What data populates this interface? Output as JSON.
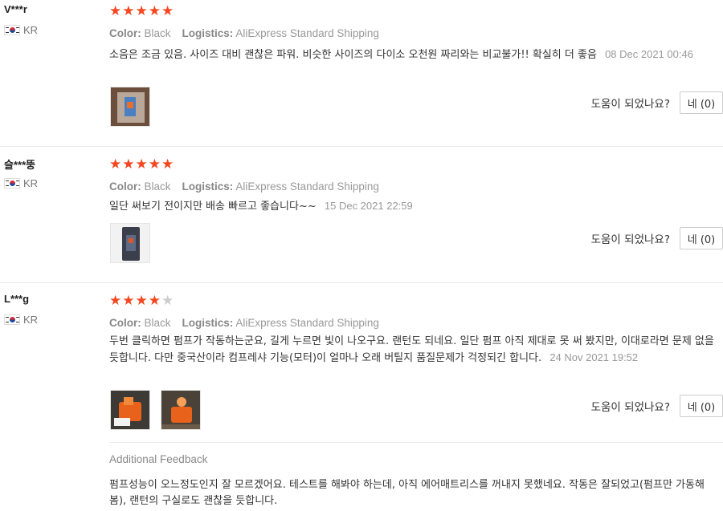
{
  "reviews": [
    {
      "user": "V***r",
      "country": "KR",
      "rating": 5,
      "color_label": "Color:",
      "color_value": "Black",
      "logistics_label": "Logistics:",
      "logistics_value": "AliExpress Standard Shipping",
      "text": "소음은 조금 있음. 사이즈 대비 괜찮은 파워. 비슷한 사이즈의 다이소 오천원 짜리와는 비교불가!! 확실히 더 좋음",
      "date": "08 Dec 2021 00:46",
      "helpful_question": "도움이 되었나요?",
      "yes_label": "네 (0)"
    },
    {
      "user": "슬***뚱",
      "country": "KR",
      "rating": 5,
      "color_label": "Color:",
      "color_value": "Black",
      "logistics_label": "Logistics:",
      "logistics_value": "AliExpress Standard Shipping",
      "text": "일단 써보기 전이지만 배송 빠르고 좋습니다~~",
      "date": "15 Dec 2021 22:59",
      "helpful_question": "도움이 되었나요?",
      "yes_label": "네 (0)"
    },
    {
      "user": "L***g",
      "country": "KR",
      "rating": 4,
      "color_label": "Color:",
      "color_value": "Black",
      "logistics_label": "Logistics:",
      "logistics_value": "AliExpress Standard Shipping",
      "text": "두번 클릭하면 펌프가 작동하는군요, 길게 누르면 빛이 나오구요. 랜턴도 되네요. 일단 펌프 아직 제대로 못 써 봤지만, 이대로라면 문제 없을 듯합니다. 다만 중국산이라 컴프레샤 기능(모터)이 얼마나 오래 버틸지 품질문제가 걱정되긴 합니다.",
      "date": "24 Nov 2021 19:52",
      "helpful_question": "도움이 되었나요?",
      "yes_label": "네 (0)",
      "additional_title": "Additional Feedback",
      "additional_text": "펌프성능이 오느정도인지 잘 모르겠어요. 테스트를 해봐야 하는데, 아직 에어매트리스를 꺼내지 못했네요. 작동은 잘되었고(펌프만 가동해 봄), 랜턴의 구실로도 괜찮을 듯합니다."
    }
  ],
  "icons": {
    "star": "star-icon",
    "flag": "south-korea-flag-icon"
  },
  "colors": {
    "star_on": "#f5461f",
    "star_off": "#cccccc",
    "meta": "#999999"
  }
}
